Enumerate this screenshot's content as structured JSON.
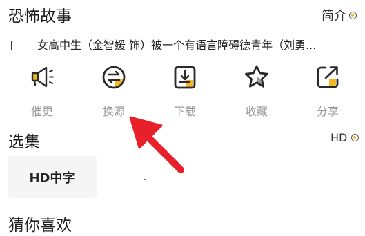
{
  "video": {
    "title": "恐怖故事",
    "intro_label": "简介",
    "description": "女高中生（金智媛 饰）被一个有语言障碍德青年（刘勇..."
  },
  "actions": [
    {
      "label": "催更",
      "icon": "megaphone-icon"
    },
    {
      "label": "换源",
      "icon": "switch-source-icon"
    },
    {
      "label": "下载",
      "icon": "download-icon"
    },
    {
      "label": "收藏",
      "icon": "star-icon"
    },
    {
      "label": "分享",
      "icon": "share-icon"
    }
  ],
  "episodes": {
    "title": "选集",
    "quality_label": "HD",
    "items": [
      {
        "label": "HD中字"
      }
    ]
  },
  "recommend": {
    "title": "猜你喜欢"
  },
  "colors": {
    "accent": "#f2b922",
    "icon_stroke": "#2a2a2a",
    "label_gray": "#9a9a9a",
    "arrow_red": "#e8202a"
  }
}
